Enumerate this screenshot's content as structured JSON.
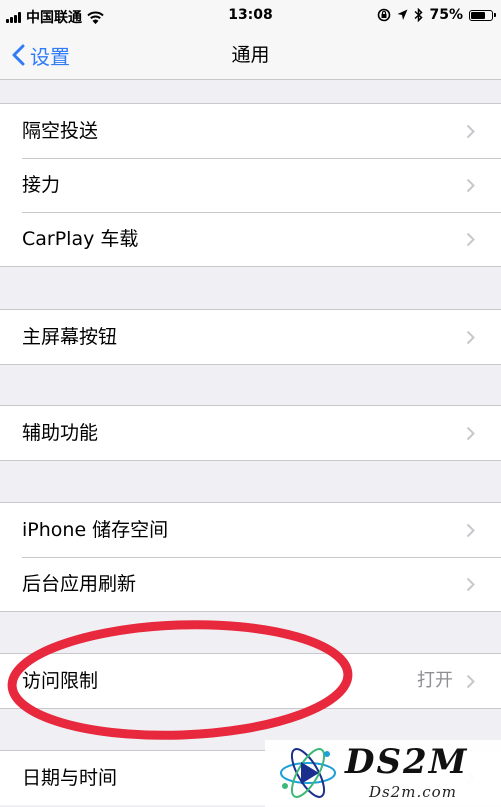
{
  "status_bar": {
    "carrier": "中国联通",
    "time": "13:08",
    "battery_text": "75%",
    "battery_level": 0.75,
    "icons": [
      "signal-icon",
      "wifi-icon",
      "orientation-lock-icon",
      "location-icon",
      "bluetooth-icon",
      "battery-icon"
    ]
  },
  "nav": {
    "back_label": "设置",
    "title": "通用"
  },
  "groups": [
    {
      "items": [
        {
          "label": "隔空投送"
        },
        {
          "label": "接力"
        },
        {
          "label": "CarPlay 车载"
        }
      ]
    },
    {
      "items": [
        {
          "label": "主屏幕按钮"
        }
      ]
    },
    {
      "items": [
        {
          "label": "辅助功能"
        }
      ]
    },
    {
      "items": [
        {
          "label": "iPhone 储存空间"
        },
        {
          "label": "后台应用刷新"
        }
      ]
    },
    {
      "items": [
        {
          "label": "访问限制",
          "value": "打开"
        }
      ]
    },
    {
      "items": [
        {
          "label": "日期与时间"
        }
      ]
    }
  ],
  "colors": {
    "accent": "#2f7cf6",
    "annotation": "#e8283c",
    "background": "#efeff4"
  },
  "watermark": {
    "title": "DS2M",
    "subtitle": "Ds2m.com"
  }
}
